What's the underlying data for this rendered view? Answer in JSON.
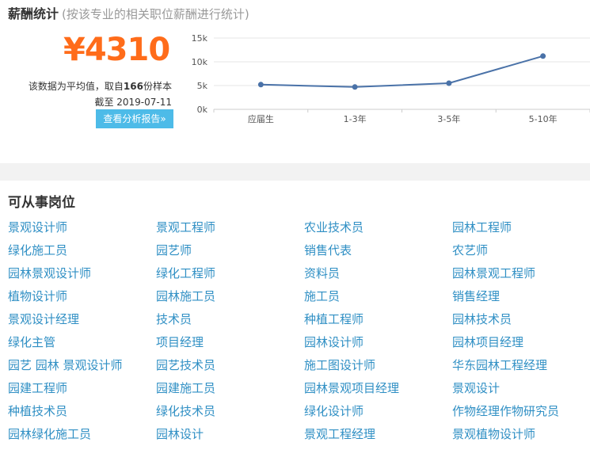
{
  "salary": {
    "title": "薪酬统计",
    "subtitle": "(按该专业的相关职位薪酬进行统计)",
    "amount": "¥4310",
    "note_prefix": "该数据为平均值，取自",
    "sample_count": "166",
    "note_suffix": "份样本",
    "cutoff": "截至 2019-07-11",
    "report_button": "查看分析报告»",
    "colors": {
      "amount": "#ff6c1a",
      "button": "#4dbbe8",
      "line": "#4a72a8"
    }
  },
  "chart_data": {
    "type": "line",
    "categories": [
      "应届生",
      "1-3年",
      "3-5年",
      "5-10年"
    ],
    "series": [
      {
        "values": [
          5200,
          4700,
          5500,
          11200
        ]
      }
    ],
    "ylim": [
      0,
      15000
    ],
    "yticks": [
      "0k",
      "5k",
      "10k",
      "15k"
    ],
    "grid": true,
    "title": "",
    "xlabel": "",
    "ylabel": ""
  },
  "jobs": {
    "title": "可从事岗位",
    "items": [
      "景观设计师",
      "景观工程师",
      "农业技术员",
      "园林工程师",
      "绿化施工员",
      "园艺师",
      "销售代表",
      "农艺师",
      "园林景观设计师",
      "绿化工程师",
      "资料员",
      "园林景观工程师",
      "植物设计师",
      "园林施工员",
      "施工员",
      "销售经理",
      "景观设计经理",
      "技术员",
      "种植工程师",
      "园林技术员",
      "绿化主管",
      "项目经理",
      "园林设计师",
      "园林项目经理",
      "园艺 园林 景观设计师",
      "园艺技术员",
      "施工图设计师",
      "华东园林工程经理",
      "园建工程师",
      "园建施工员",
      "园林景观项目经理",
      "景观设计",
      "种植技术员",
      "绿化技术员",
      "绿化设计师",
      "作物经理作物研究员",
      "园林绿化施工员",
      "园林设计",
      "景观工程经理",
      "景观植物设计师"
    ]
  }
}
